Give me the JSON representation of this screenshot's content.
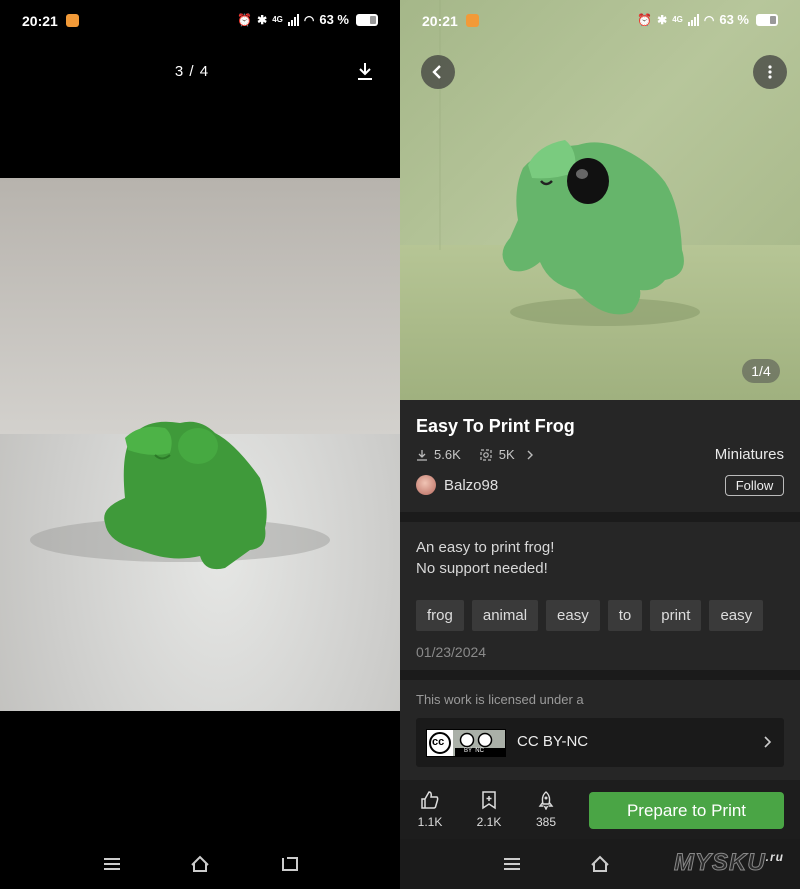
{
  "status_bar": {
    "time": "20:21",
    "battery": "63 %",
    "network": "4G"
  },
  "viewer": {
    "counter": "3 / 4",
    "download_icon": "download-icon"
  },
  "detail": {
    "image_counter": "1/4",
    "title": "Easy To Print Frog",
    "downloads": "5.6K",
    "prints": "5K",
    "category": "Miniatures",
    "author": "Balzo98",
    "follow_label": "Follow",
    "description_line1": "An easy to print frog!",
    "description_line2": "No support needed!",
    "tags": [
      "frog",
      "animal",
      "easy",
      "to",
      "print",
      "easy"
    ],
    "date": "01/23/2024",
    "license_note": "This work is licensed under a",
    "license_badge_text": "BY  NC",
    "license_name": "CC BY-NC",
    "likes": "1.1K",
    "collects": "2.1K",
    "boosts": "385",
    "prepare_label": "Prepare to Print"
  },
  "watermark": {
    "text": "MYSKU",
    "suffix": ".ru"
  },
  "colors": {
    "accent_green": "#4aa545",
    "panel": "#262626",
    "background": "#1b1b1b"
  }
}
